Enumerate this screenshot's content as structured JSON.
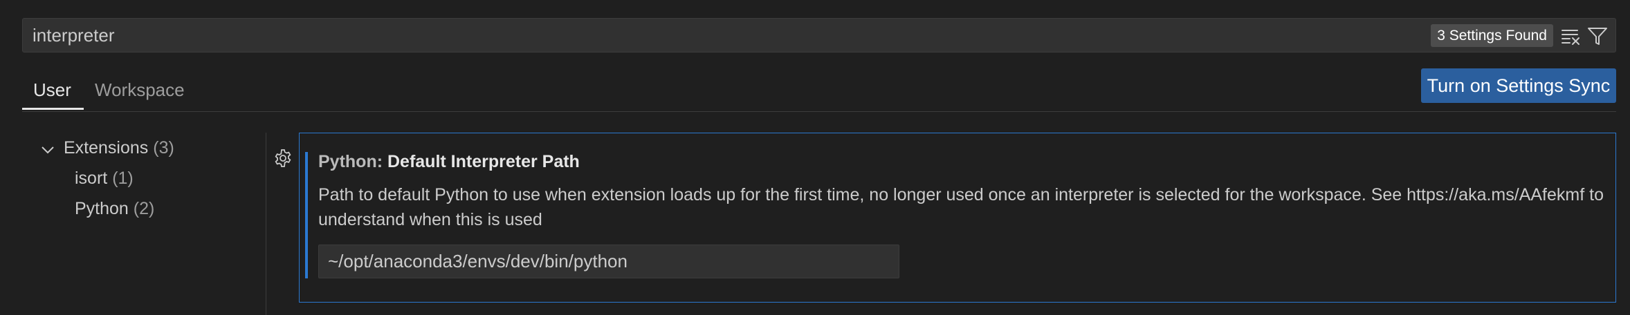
{
  "search": {
    "query": "interpreter",
    "results_count": "3 Settings Found",
    "clear_icon": "clear-filter-icon",
    "filter_icon": "filter-icon"
  },
  "tabs": [
    {
      "label": "User",
      "active": true
    },
    {
      "label": "Workspace",
      "active": false
    }
  ],
  "sync_button": "Turn on Settings Sync",
  "toc": {
    "root": {
      "label": "Extensions",
      "count": "(3)",
      "expanded": true
    },
    "items": [
      {
        "label": "isort",
        "count": "(1)"
      },
      {
        "label": "Python",
        "count": "(2)"
      }
    ]
  },
  "setting": {
    "category": "Python: ",
    "name": "Default Interpreter Path",
    "description": "Path to default Python to use when extension loads up for the first time, no longer used once an interpreter is selected for the workspace. See https://aka.ms/AAfekmf to understand when this is used",
    "value": "~/opt/anaconda3/envs/dev/bin/python",
    "gear_icon": "gear-icon"
  },
  "colors": {
    "background": "#1f1f1f",
    "accent": "#2b79d1",
    "sync_button_bg": "#2b5f9e"
  }
}
